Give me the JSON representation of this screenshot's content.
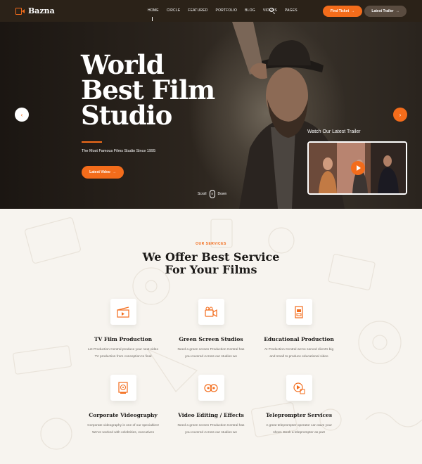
{
  "nav": {
    "logo": "Bazna",
    "items": [
      "HOME",
      "CIRCLE",
      "FEATURED",
      "PORTFOLIO",
      "BLOG",
      "VIDEOS",
      "PAGES"
    ],
    "find_ticket": "Find Ticket",
    "latest_trailer": "Latest Trailer"
  },
  "hero": {
    "title_lines": [
      "World",
      "Best Film",
      "Studio"
    ],
    "subtitle": "The Most Famous Films Studio Since 1995",
    "button": "Latest Video",
    "scroll_left": "Scroll",
    "scroll_right": "Down",
    "trailer_label": "Watch Our Latest Trailer"
  },
  "services": {
    "kicker": "OUR SERVICES",
    "title_lines": [
      "We Offer Best Service",
      "For Your Films"
    ],
    "cards": [
      {
        "icon": "clapperboard-icon",
        "title": "TV Film Production",
        "text": [
          "Let Production Central produce your next video",
          "TV production from conception to final"
        ]
      },
      {
        "icon": "video-camera-icon",
        "title": "Green Screen Studios",
        "text": [
          "Need a green screen Production Central has",
          "you covered Across our studios we"
        ]
      },
      {
        "icon": "film-strip-icon",
        "title": "Educational Production",
        "text": [
          "At Production Central we've served client's big",
          "and small to produce educational video"
        ]
      },
      {
        "icon": "film-reel-icon",
        "title": "Corporate Videography",
        "text": [
          "Corporate videography is one of our specialties!",
          "We've worked with celebrities, executives"
        ]
      },
      {
        "icon": "film-rolls-icon",
        "title": "Video Editing / Effects",
        "text": [
          "Need a green screen Production Central has",
          "you covered Across our studios we"
        ]
      },
      {
        "icon": "teleprompter-icon",
        "title": "Teleprompter Services",
        "text": [
          "A great teleprompter operator can save your",
          "shoot. Book a teleprompter as part"
        ]
      }
    ]
  },
  "colors": {
    "accent": "#f36c1b",
    "nav_bg": "#2b2218",
    "section_bg": "#f7f4ef"
  }
}
